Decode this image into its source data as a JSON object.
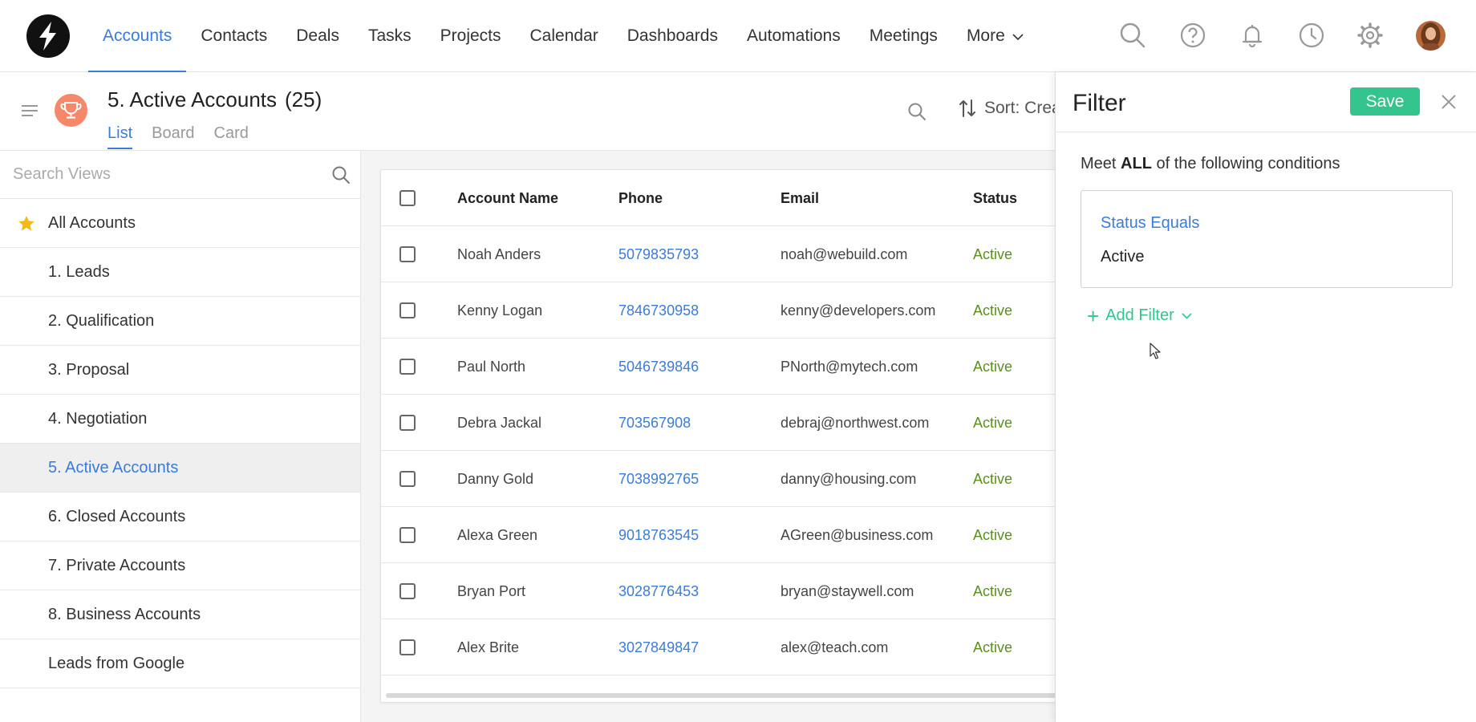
{
  "nav": {
    "items": [
      {
        "label": "Accounts",
        "name": "nav-accounts",
        "active": true
      },
      {
        "label": "Contacts",
        "name": "nav-contacts"
      },
      {
        "label": "Deals",
        "name": "nav-deals"
      },
      {
        "label": "Tasks",
        "name": "nav-tasks"
      },
      {
        "label": "Projects",
        "name": "nav-projects"
      },
      {
        "label": "Calendar",
        "name": "nav-calendar"
      },
      {
        "label": "Dashboards",
        "name": "nav-dashboards"
      },
      {
        "label": "Automations",
        "name": "nav-automations"
      },
      {
        "label": "Meetings",
        "name": "nav-meetings"
      },
      {
        "label": "More",
        "name": "nav-more",
        "dropdown": true
      }
    ],
    "icons": [
      "search-icon",
      "help-icon",
      "bell-icon",
      "clock-icon",
      "gear-icon"
    ]
  },
  "view": {
    "title": "5. Active Accounts",
    "count": "(25)",
    "tabs": [
      {
        "label": "List",
        "active": true
      },
      {
        "label": "Board"
      },
      {
        "label": "Card"
      }
    ],
    "sort_label": "Sort: Crea"
  },
  "sidebar": {
    "search_placeholder": "Search Views",
    "items": [
      {
        "label": "All Accounts",
        "starred": true
      },
      {
        "label": "1. Leads"
      },
      {
        "label": "2. Qualification"
      },
      {
        "label": "3. Proposal"
      },
      {
        "label": "4. Negotiation"
      },
      {
        "label": "5. Active Accounts",
        "active": true
      },
      {
        "label": "6. Closed Accounts"
      },
      {
        "label": "7. Private Accounts"
      },
      {
        "label": "8. Business Accounts"
      },
      {
        "label": "Leads from Google"
      }
    ]
  },
  "table": {
    "columns": [
      "Account Name",
      "Phone",
      "Email",
      "Status"
    ],
    "rows": [
      {
        "name": "Noah Anders",
        "phone": "5079835793",
        "email": "noah@webuild.com",
        "status": "Active"
      },
      {
        "name": "Kenny Logan",
        "phone": "7846730958",
        "email": "kenny@developers.com",
        "status": "Active"
      },
      {
        "name": "Paul North",
        "phone": "5046739846",
        "email": "PNorth@mytech.com",
        "status": "Active"
      },
      {
        "name": "Debra Jackal",
        "phone": "703567908",
        "email": "debraj@northwest.com",
        "status": "Active"
      },
      {
        "name": "Danny Gold",
        "phone": "7038992765",
        "email": "danny@housing.com",
        "status": "Active"
      },
      {
        "name": "Alexa Green",
        "phone": "9018763545",
        "email": "AGreen@business.com",
        "status": "Active"
      },
      {
        "name": "Bryan Port",
        "phone": "3028776453",
        "email": "bryan@staywell.com",
        "status": "Active"
      },
      {
        "name": "Alex Brite",
        "phone": "3027849847",
        "email": "alex@teach.com",
        "status": "Active"
      }
    ]
  },
  "filter": {
    "title": "Filter",
    "save_label": "Save",
    "meet_prefix": "Meet",
    "meet_bold": "ALL",
    "meet_suffix": "of the following conditions",
    "condition_label": "Status Equals",
    "condition_value": "Active",
    "add_filter_label": "Add Filter"
  },
  "colors": {
    "accent": "#3b7bd9",
    "save": "#34c48d",
    "status_active": "#5a8f1e",
    "trophy": "#f5876b"
  }
}
